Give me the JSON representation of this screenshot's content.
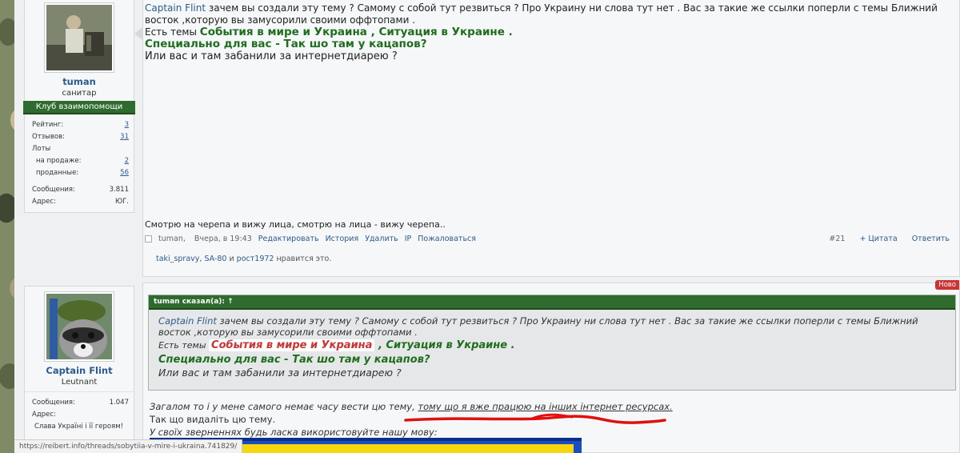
{
  "post1": {
    "user": {
      "name": "tuman",
      "title": "санитар",
      "club": "Клуб взаимопомощи",
      "stats": [
        {
          "label": "Рейтинг:",
          "value": "3",
          "link": true,
          "indent": false
        },
        {
          "label": "Отзывов:",
          "value": "31",
          "link": true,
          "indent": false
        },
        {
          "label": "Лоты",
          "value": "",
          "link": false,
          "indent": false
        },
        {
          "label": "на продаже:",
          "value": "2",
          "link": true,
          "indent": true
        },
        {
          "label": "проданные:",
          "value": "56",
          "link": true,
          "indent": true
        },
        {
          "label": "Сообщения:",
          "value": "3.811",
          "link": false,
          "indent": false
        },
        {
          "label": "Адрес:",
          "value": "ЮГ.",
          "link": false,
          "indent": false
        }
      ]
    },
    "message": {
      "mention": "Captain Flint",
      "line1": " зачем вы создали эту тему ? Самому с собой тут резвиться ? Про Украину ни слова тут нет . Вас за такие же ссылки поперли с темы Ближний восток ,которую вы замусорили своими оффтопами .",
      "line2_prefix": "Есть темы ",
      "topic1": "События в мире и Украина",
      "sep": " , ",
      "topic2": "Ситуация в Украине",
      "dot": " .",
      "line3": "Специально для вас - Так шо там у кацапов?",
      "line4": "Или вас и там забанили за интернетдиарею ?"
    },
    "signature": "Смотрю на черепа и вижу лица, смотрю на лица - вижу черепа..",
    "footer": {
      "author": "tuman",
      "time": "Вчера, в 19:43",
      "actions": [
        "Редактировать",
        "История",
        "Удалить",
        "IP",
        "Пожаловаться"
      ],
      "post_no": "#21",
      "quote": "+ Цитата",
      "reply": "Ответить"
    },
    "likes": {
      "users": [
        "taki_spravy",
        "SA-80"
      ],
      "and": " и ",
      "last": "рост1972",
      "suffix": " нравится это."
    }
  },
  "post2": {
    "badge": "Ново",
    "user": {
      "name": "Captain Flint",
      "title": "Leutnant",
      "stats": [
        {
          "label": "Сообщения:",
          "value": "1.047"
        },
        {
          "label": "Адрес:",
          "value": ""
        }
      ],
      "motto": "Слава Україні і її героям!"
    },
    "quote": {
      "header": "tuman сказал(а): ↑",
      "mention": "Captain Flint",
      "line1": " зачем вы создали эту тему ? Самому с собой тут резвиться ? Про Украину ни слова тут нет . Вас за такие же ссылки поперли с темы Ближний восток ,которую вы замусорили своими оффтопами .",
      "line2_prefix": "Есть темы ",
      "topic1": "События в мире и Украина",
      "sep": " , ",
      "topic2": "Ситуация в Украине",
      "dot": " .",
      "line3": "Специально для вас - Так шо там у кацапов?",
      "line4": "Или вас и там забанили за интернетдиарею ?"
    },
    "reply": {
      "line1_a": "Загалом то і у мене самого немає часу вести цю тему, ",
      "line1_b": "тому що я вже працюю на інших інтернет ресурсах.",
      "line2": "Так що видаліть цю тему.",
      "line3": "У своїх зверненнях будь ласка використовуйте нашу мову:"
    }
  },
  "statusbar": "https://reibert.info/threads/sobytiia-v-mire-i-ukraina.741829/",
  "colors": {
    "accent_green": "#2f6b2f",
    "link": "#2d5b8d",
    "highlight_red": "#c33"
  }
}
